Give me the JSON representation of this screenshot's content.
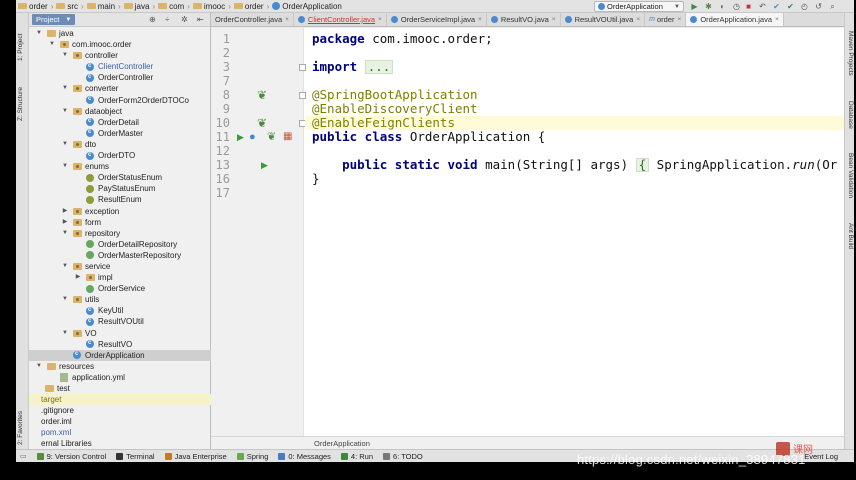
{
  "breadcrumb": [
    "order",
    "src",
    "main",
    "java",
    "com",
    "imooc",
    "order",
    "OrderApplication"
  ],
  "run_config": "OrderApplication",
  "project_panel": {
    "tab_label": "Project",
    "tree": [
      {
        "label": "java",
        "depth": 0,
        "type": "folder",
        "open": true
      },
      {
        "label": "com.imooc.order",
        "depth": 1,
        "type": "pkg",
        "open": true
      },
      {
        "label": "controller",
        "depth": 2,
        "type": "pkg",
        "open": true
      },
      {
        "label": "ClientController",
        "depth": 3,
        "type": "cls",
        "color": "mod"
      },
      {
        "label": "OrderController",
        "depth": 3,
        "type": "cls"
      },
      {
        "label": "converter",
        "depth": 2,
        "type": "pkg",
        "open": true
      },
      {
        "label": "OrderForm2OrderDTOCo",
        "depth": 3,
        "type": "cls"
      },
      {
        "label": "dataobject",
        "depth": 2,
        "type": "pkg",
        "open": true
      },
      {
        "label": "OrderDetail",
        "depth": 3,
        "type": "cls"
      },
      {
        "label": "OrderMaster",
        "depth": 3,
        "type": "cls"
      },
      {
        "label": "dto",
        "depth": 2,
        "type": "pkg",
        "open": true
      },
      {
        "label": "OrderDTO",
        "depth": 3,
        "type": "cls"
      },
      {
        "label": "enums",
        "depth": 2,
        "type": "pkg",
        "open": true
      },
      {
        "label": "OrderStatusEnum",
        "depth": 3,
        "type": "enm"
      },
      {
        "label": "PayStatusEnum",
        "depth": 3,
        "type": "enm"
      },
      {
        "label": "ResultEnum",
        "depth": 3,
        "type": "enm"
      },
      {
        "label": "exception",
        "depth": 2,
        "type": "pkg",
        "open": false
      },
      {
        "label": "form",
        "depth": 2,
        "type": "pkg",
        "open": false
      },
      {
        "label": "repository",
        "depth": 2,
        "type": "pkg",
        "open": true
      },
      {
        "label": "OrderDetailRepository",
        "depth": 3,
        "type": "itf"
      },
      {
        "label": "OrderMasterRepository",
        "depth": 3,
        "type": "itf"
      },
      {
        "label": "service",
        "depth": 2,
        "type": "pkg",
        "open": true
      },
      {
        "label": "impl",
        "depth": 3,
        "type": "pkg",
        "open": false
      },
      {
        "label": "OrderService",
        "depth": 3,
        "type": "itf"
      },
      {
        "label": "utils",
        "depth": 2,
        "type": "pkg",
        "open": true
      },
      {
        "label": "KeyUtil",
        "depth": 3,
        "type": "cls"
      },
      {
        "label": "ResultVOUtil",
        "depth": 3,
        "type": "cls"
      },
      {
        "label": "VO",
        "depth": 2,
        "type": "pkg",
        "open": true
      },
      {
        "label": "ResultVO",
        "depth": 3,
        "type": "cls"
      },
      {
        "label": "OrderApplication",
        "depth": 2,
        "type": "cls",
        "selected": true
      },
      {
        "label": "resources",
        "depth": 0,
        "type": "folder",
        "open": true
      },
      {
        "label": "application.yml",
        "depth": 1,
        "type": "yml"
      },
      {
        "label": "test",
        "depth": -1,
        "type": "folder"
      },
      {
        "label": "target",
        "depth": -2,
        "type": "none",
        "color": "olive",
        "highlight": true
      },
      {
        "label": ".gitignore",
        "depth": -2,
        "type": "none"
      },
      {
        "label": "order.iml",
        "depth": -2,
        "type": "none"
      },
      {
        "label": "pom.xml",
        "depth": -2,
        "type": "none",
        "color": "mod"
      },
      {
        "label": "ernal Libraries",
        "depth": -2,
        "type": "none"
      }
    ]
  },
  "tabs": [
    {
      "label": "OrderController.java",
      "icon": "none",
      "active": false
    },
    {
      "label": "ClientController.java",
      "icon": "cls",
      "error": true
    },
    {
      "label": "OrderServiceImpl.java",
      "icon": "cls"
    },
    {
      "label": "ResultVO.java",
      "icon": "cls"
    },
    {
      "label": "ResultVOUtil.java",
      "icon": "cls"
    },
    {
      "label": "order",
      "icon": "m"
    },
    {
      "label": "OrderApplication.java",
      "icon": "cls",
      "active": true
    }
  ],
  "editor": {
    "lines": [
      {
        "num": "1",
        "html": "<span class='kw'>package</span> com.imooc.order;"
      },
      {
        "num": "2",
        "html": ""
      },
      {
        "num": "3",
        "html": "<span class='kw'>import</span> <span class='fold-box'>...</span>"
      },
      {
        "num": "7",
        "html": ""
      },
      {
        "num": "8",
        "html": "<span class='ann'>@SpringBootApplication</span>"
      },
      {
        "num": "9",
        "html": "<span class='ann'>@EnableDiscoveryClient</span>"
      },
      {
        "num": "10",
        "html": "<span class='ann'>@EnableFeignClients</span>"
      },
      {
        "num": "11",
        "html": "<span class='kw'>public class</span> OrderApplication {"
      },
      {
        "num": "12",
        "html": ""
      },
      {
        "num": "13",
        "html": "    <span class='kw'>public static void</span> main(String[] args) <span class='fold-box'>{</span> SpringApplication.<span class='it'>run</span>(Or"
      },
      {
        "num": "16",
        "html": "}"
      },
      {
        "num": "17",
        "html": ""
      }
    ],
    "bottom_breadcrumb": "OrderApplication"
  },
  "left_tool_tabs": [
    "1: Project",
    "Z: Structure",
    "2: Favorites"
  ],
  "right_tool_tabs": [
    "Maven Projects",
    "Database",
    "Bean Validation",
    "Ant Build"
  ],
  "bottom_tools": [
    {
      "label": "9: Version Control",
      "color": "#5a8a3a"
    },
    {
      "label": "Terminal",
      "color": "#333333"
    },
    {
      "label": "Java Enterprise",
      "color": "#c07a2a"
    },
    {
      "label": "Spring",
      "color": "#6aa84f"
    },
    {
      "label": "0: Messages",
      "color": "#4a79c0"
    },
    {
      "label": "4: Run",
      "color": "#3a8a3a"
    },
    {
      "label": "6: TODO",
      "color": "#777777"
    }
  ],
  "event_log": "Event Log",
  "watermark": "https://blog.csdn.net/weixin_38947831",
  "colors": {
    "annotation": "#808000",
    "keyword": "#000080",
    "selection": "#cfcfcf"
  }
}
